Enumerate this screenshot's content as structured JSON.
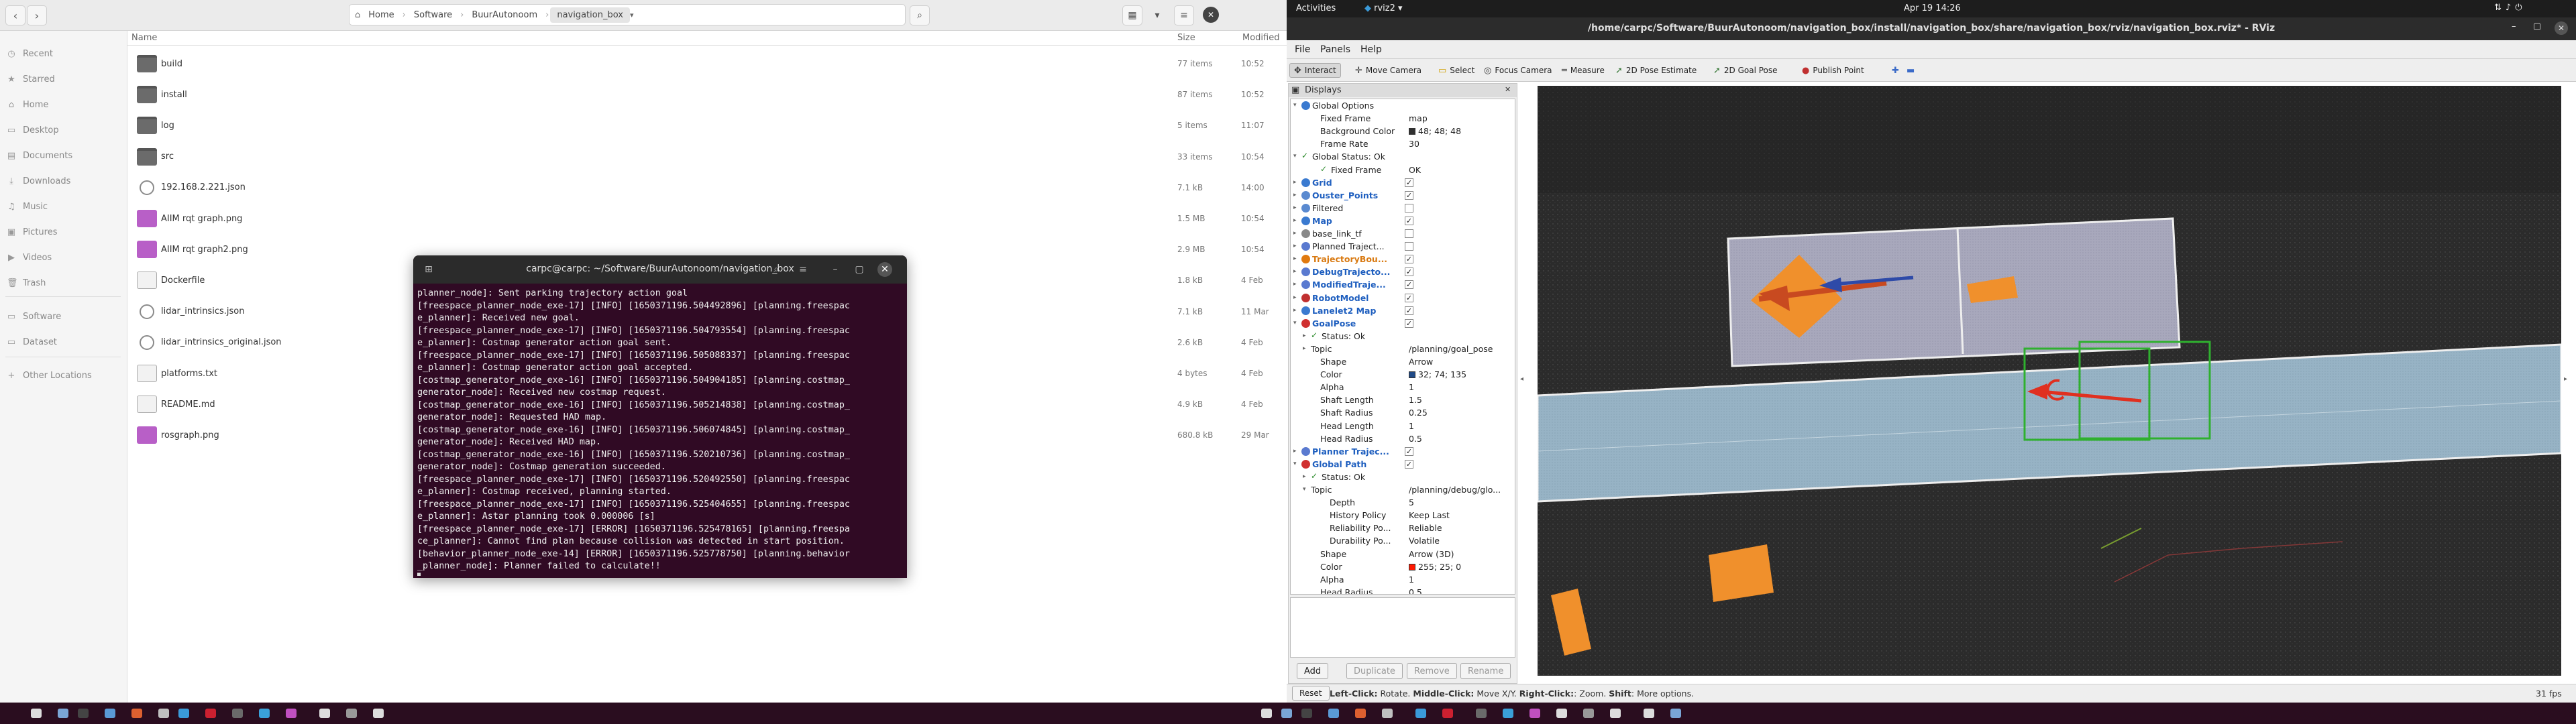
{
  "file_manager": {
    "nav": {
      "back": "‹",
      "forward": "›"
    },
    "breadcrumbs": [
      "Home",
      "Software",
      "BuurAutonoom",
      "navigation_box"
    ],
    "sidebar": [
      {
        "label": "Recent",
        "icon": "clock-icon",
        "glyph": "◷"
      },
      {
        "label": "Starred",
        "icon": "star-icon",
        "glyph": "★"
      },
      {
        "label": "Home",
        "icon": "home-icon",
        "glyph": "⌂"
      },
      {
        "label": "Desktop",
        "icon": "desktop-icon",
        "glyph": "▭"
      },
      {
        "label": "Documents",
        "icon": "document-icon",
        "glyph": "▤"
      },
      {
        "label": "Downloads",
        "icon": "download-icon",
        "glyph": "⤓"
      },
      {
        "label": "Music",
        "icon": "music-icon",
        "glyph": "♫"
      },
      {
        "label": "Pictures",
        "icon": "picture-icon",
        "glyph": "▣"
      },
      {
        "label": "Videos",
        "icon": "video-icon",
        "glyph": "▶"
      },
      {
        "label": "Trash",
        "icon": "trash-icon",
        "glyph": "🗑"
      },
      {
        "label": "Software",
        "icon": "folder-icon",
        "glyph": "▭"
      },
      {
        "label": "Dataset",
        "icon": "folder-icon",
        "glyph": "▭"
      },
      {
        "label": "Other Locations",
        "icon": "plus-icon",
        "glyph": "+"
      }
    ],
    "columns": {
      "name": "Name",
      "size": "Size",
      "modified": "Modified"
    },
    "files": [
      {
        "name": "build",
        "size": "77 items",
        "modified": "10:52",
        "type": "folder"
      },
      {
        "name": "install",
        "size": "87 items",
        "modified": "10:52",
        "type": "folder"
      },
      {
        "name": "log",
        "size": "5 items",
        "modified": "11:07",
        "type": "folder"
      },
      {
        "name": "src",
        "size": "33 items",
        "modified": "10:54",
        "type": "folder"
      },
      {
        "name": "192.168.2.221.json",
        "size": "7.1 kB",
        "modified": "14:00",
        "type": "json"
      },
      {
        "name": "AIIM rqt graph.png",
        "size": "1.5 MB",
        "modified": "10:54",
        "type": "image"
      },
      {
        "name": "AIIM rqt graph2.png",
        "size": "2.9 MB",
        "modified": "10:54",
        "type": "image"
      },
      {
        "name": "Dockerfile",
        "size": "1.8 kB",
        "modified": "4 Feb",
        "type": "text"
      },
      {
        "name": "lidar_intrinsics.json",
        "size": "7.1 kB",
        "modified": "11 Mar",
        "type": "json"
      },
      {
        "name": "lidar_intrinsics_original.json",
        "size": "2.6 kB",
        "modified": "4 Feb",
        "type": "json"
      },
      {
        "name": "platforms.txt",
        "size": "4 bytes",
        "modified": "4 Feb",
        "type": "text"
      },
      {
        "name": "README.md",
        "size": "4.9 kB",
        "modified": "4 Feb",
        "type": "text"
      },
      {
        "name": "rosgraph.png",
        "size": "680.8 kB",
        "modified": "29 Mar",
        "type": "image"
      }
    ]
  },
  "terminal": {
    "title": "carpc@carpc: ~/Software/BuurAutonoom/navigation_box",
    "lines": [
      "planner_node]: Sent parking trajectory action goal",
      "[freespace_planner_node_exe-17] [INFO] [1650371196.504492896] [planning.freespac",
      "e_planner]: Received new goal.",
      "[freespace_planner_node_exe-17] [INFO] [1650371196.504793554] [planning.freespac",
      "e_planner]: Costmap generator action goal sent.",
      "[freespace_planner_node_exe-17] [INFO] [1650371196.505088337] [planning.freespac",
      "e_planner]: Costmap generator action goal accepted.",
      "[costmap_generator_node_exe-16] [INFO] [1650371196.504904185] [planning.costmap_",
      "generator_node]: Received new costmap request.",
      "[costmap_generator_node_exe-16] [INFO] [1650371196.505214838] [planning.costmap_",
      "generator_node]: Requested HAD map.",
      "[costmap_generator_node_exe-16] [INFO] [1650371196.506074845] [planning.costmap_",
      "generator_node]: Received HAD map.",
      "[costmap_generator_node_exe-16] [INFO] [1650371196.520210736] [planning.costmap_",
      "generator_node]: Costmap generation succeeded.",
      "[freespace_planner_node_exe-17] [INFO] [1650371196.520492550] [planning.freespac",
      "e_planner]: Costmap received, planning started.",
      "[freespace_planner_node_exe-17] [INFO] [1650371196.525404655] [planning.freespac",
      "e_planner]: Astar planning took 0.000006 [s]",
      "[freespace_planner_node_exe-17] [ERROR] [1650371196.525478165] [planning.freespa",
      "ce_planner]: Cannot find plan because collision was detected in start position.",
      "[behavior_planner_node_exe-14] [ERROR] [1650371196.525778750] [planning.behavior",
      "_planner_node]: Planner failed to calculate!!"
    ],
    "cursor": "▋"
  },
  "system": {
    "activities": "Activities",
    "app": "rviz2",
    "clock": "Apr 19  14:26"
  },
  "rviz": {
    "window_title": "/home/carpc/Software/BuurAutonoom/navigation_box/install/navigation_box/share/navigation_box/rviz/navigation_box.rviz* - RViz",
    "menus": [
      "File",
      "Panels",
      "Help"
    ],
    "tools": [
      {
        "label": "Interact",
        "glyph": "✥",
        "icon": "interact-icon"
      },
      {
        "label": "Move Camera",
        "glyph": "✛",
        "icon": "move-camera-icon"
      },
      {
        "label": "Select",
        "glyph": "▭",
        "icon": "select-icon"
      },
      {
        "label": "Focus Camera",
        "glyph": "◎",
        "icon": "focus-camera-icon"
      },
      {
        "label": "Measure",
        "glyph": "═",
        "icon": "measure-icon"
      },
      {
        "label": "2D Pose Estimate",
        "glyph": "➚",
        "icon": "pose-estimate-icon"
      },
      {
        "label": "2D Goal Pose",
        "glyph": "➚",
        "icon": "goal-pose-icon"
      },
      {
        "label": "Publish Point",
        "glyph": "●",
        "icon": "publish-point-icon"
      },
      {
        "label": "",
        "glyph": "✚",
        "icon": "add-tool-icon"
      },
      {
        "label": "",
        "glyph": "▬",
        "icon": "remove-tool-icon"
      }
    ],
    "displays_title": "Displays",
    "tree": [
      {
        "indent": 0,
        "label": "Global Options",
        "icon": "globe",
        "exp": "▾",
        "value": ""
      },
      {
        "indent": 2,
        "label": "Fixed Frame",
        "value": "map"
      },
      {
        "indent": 2,
        "label": "Background Color",
        "value": "48; 48; 48",
        "swatch": "#303030"
      },
      {
        "indent": 2,
        "label": "Frame Rate",
        "value": "30"
      },
      {
        "indent": 0,
        "label": "Global Status: Ok",
        "icon": "check",
        "exp": "▾",
        "value": ""
      },
      {
        "indent": 2,
        "label": "Fixed Frame",
        "icon": "check",
        "value": "OK"
      },
      {
        "indent": 0,
        "label": "Grid",
        "icon": "grid",
        "exp": "▸",
        "style": "blue",
        "check": "✓"
      },
      {
        "indent": 0,
        "label": "Ouster_Points",
        "icon": "points",
        "exp": "▸",
        "style": "blue",
        "check": "✓"
      },
      {
        "indent": 0,
        "label": "Filtered",
        "icon": "points",
        "exp": "▸",
        "check": ""
      },
      {
        "indent": 0,
        "label": "Map",
        "icon": "map",
        "exp": "▸",
        "style": "blue",
        "check": "✓"
      },
      {
        "indent": 0,
        "label": "base_link_tf",
        "icon": "tf",
        "exp": "▸",
        "check": ""
      },
      {
        "indent": 0,
        "label": "Planned Traject...",
        "icon": "path",
        "exp": "▸",
        "check": ""
      },
      {
        "indent": 0,
        "label": "TrajectoryBou...",
        "icon": "warn",
        "exp": "▸",
        "style": "orange",
        "check": "✓"
      },
      {
        "indent": 0,
        "label": "DebugTrajecto...",
        "icon": "path",
        "exp": "▸",
        "style": "blue",
        "check": "✓"
      },
      {
        "indent": 0,
        "label": "ModifiedTraje...",
        "icon": "path",
        "exp": "▸",
        "style": "blue",
        "check": "✓"
      },
      {
        "indent": 0,
        "label": "RobotModel",
        "icon": "robot",
        "exp": "▸",
        "style": "blue",
        "check": "✓"
      },
      {
        "indent": 0,
        "label": "Lanelet2 Map",
        "icon": "map",
        "exp": "▸",
        "style": "blue",
        "check": "✓"
      },
      {
        "indent": 0,
        "label": "GoalPose",
        "icon": "arrow",
        "exp": "▾",
        "style": "blue",
        "check": "✓"
      },
      {
        "indent": 1,
        "label": "Status: Ok",
        "icon": "check",
        "exp": "▸",
        "value": ""
      },
      {
        "indent": 1,
        "label": "Topic",
        "exp": "▸",
        "value": "/planning/goal_pose"
      },
      {
        "indent": 2,
        "label": "Shape",
        "value": "Arrow"
      },
      {
        "indent": 2,
        "label": "Color",
        "value": "32; 74; 135",
        "swatch": "#204a87"
      },
      {
        "indent": 2,
        "label": "Alpha",
        "value": "1"
      },
      {
        "indent": 2,
        "label": "Shaft Length",
        "value": "1.5"
      },
      {
        "indent": 2,
        "label": "Shaft Radius",
        "value": "0.25"
      },
      {
        "indent": 2,
        "label": "Head Length",
        "value": "1"
      },
      {
        "indent": 2,
        "label": "Head Radius",
        "value": "0.5"
      },
      {
        "indent": 0,
        "label": "Planner Trajec...",
        "icon": "path",
        "exp": "▸",
        "style": "blue",
        "check": "✓"
      },
      {
        "indent": 0,
        "label": "Global Path",
        "icon": "arrow",
        "exp": "▾",
        "style": "blue",
        "check": "✓"
      },
      {
        "indent": 1,
        "label": "Status: Ok",
        "icon": "check",
        "exp": "▸",
        "value": ""
      },
      {
        "indent": 1,
        "label": "Topic",
        "exp": "▾",
        "value": "/planning/debug/glo..."
      },
      {
        "indent": 3,
        "label": "Depth",
        "value": "5"
      },
      {
        "indent": 3,
        "label": "History Policy",
        "value": "Keep Last"
      },
      {
        "indent": 3,
        "label": "Reliability Po...",
        "value": "Reliable"
      },
      {
        "indent": 3,
        "label": "Durability Po...",
        "value": "Volatile"
      },
      {
        "indent": 2,
        "label": "Shape",
        "value": "Arrow (3D)"
      },
      {
        "indent": 2,
        "label": "Color",
        "value": "255; 25; 0",
        "swatch": "#ff1900"
      },
      {
        "indent": 2,
        "label": "Alpha",
        "value": "1"
      },
      {
        "indent": 2,
        "label": "Head Radius",
        "value": "0.5"
      }
    ],
    "buttons": {
      "add": "Add",
      "duplicate": "Duplicate",
      "remove": "Remove",
      "rename": "Rename"
    },
    "status": {
      "reset": "Reset",
      "hint_bold1": "Left-Click:",
      "hint1": " Rotate. ",
      "hint_bold2": "Middle-Click:",
      "hint2": " Move X/Y. ",
      "hint_bold3": "Right-Click:",
      "hint3": ": Zoom. ",
      "hint_bold4": "Shift",
      "hint4": ": More options.",
      "fps": "31 fps"
    }
  }
}
